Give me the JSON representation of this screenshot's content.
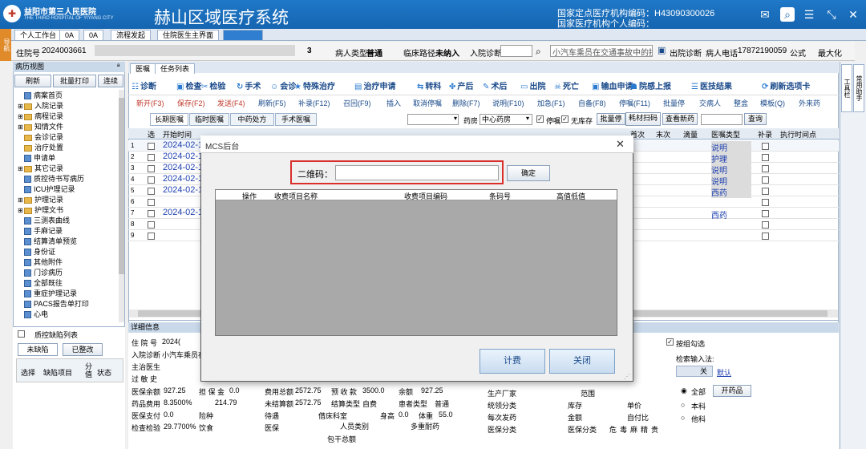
{
  "titlebar": {
    "hospital_name": "益阳市第三人民医院",
    "hospital_en": "THE THIRD HOSPITAL OF YIYANG CITY",
    "app_title": "赫山区域医疗系统",
    "org_code_line": "国家定点医疗机构编码：H43090300026",
    "person_code_line": "国家医疗机构个人编码："
  },
  "left_vertical_tab": "导航",
  "tabs": [
    "个人工作台",
    "0A",
    "0A",
    "流程发起",
    "住院医生主界面",
    ""
  ],
  "patient_bar": {
    "admission_no_label": "住院号",
    "admission_no": "2024003661",
    "bed_count": "3",
    "patient_type_label": "病人类型",
    "patient_type": "普通",
    "clinical_path_label": "临床路径",
    "clinical_path": "未纳入",
    "admit_diag_label": "入院诊断",
    "diag_text": "小汽车乘员在交通事故中的损",
    "discharge_diag": "出院诊断",
    "phone_label": "病人电话",
    "phone": "17872190059",
    "fee_type": "公式",
    "maximize": "最大化"
  },
  "left_panel": {
    "title": "病历视图",
    "pin": "ª",
    "buttons": [
      "刷新",
      "批量打印",
      "连续"
    ],
    "tree": [
      {
        "label": "病案首页",
        "kind": "doc",
        "exp": ""
      },
      {
        "label": "入院记录",
        "kind": "folder",
        "exp": "⊞"
      },
      {
        "label": "病程记录",
        "kind": "folder",
        "exp": "⊞"
      },
      {
        "label": "知情文件",
        "kind": "folder",
        "exp": "⊞"
      },
      {
        "label": "会诊记录",
        "kind": "folder",
        "exp": ""
      },
      {
        "label": "治疗处置",
        "kind": "folder",
        "exp": ""
      },
      {
        "label": "申请单",
        "kind": "doc",
        "exp": ""
      },
      {
        "label": "其它记录",
        "kind": "folder",
        "exp": "⊞"
      },
      {
        "label": "质控待书写病历",
        "kind": "doc",
        "exp": ""
      },
      {
        "label": "ICU护理记录",
        "kind": "doc",
        "exp": ""
      },
      {
        "label": "护理记录",
        "kind": "folder",
        "exp": "⊞"
      },
      {
        "label": "护理文书",
        "kind": "folder",
        "exp": "⊞"
      },
      {
        "label": "三测表曲线",
        "kind": "doc",
        "exp": ""
      },
      {
        "label": "手麻记录",
        "kind": "doc",
        "exp": ""
      },
      {
        "label": "结算清单预览",
        "kind": "doc",
        "exp": ""
      },
      {
        "label": "身份证",
        "kind": "doc",
        "exp": ""
      },
      {
        "label": "其他附件",
        "kind": "doc",
        "exp": ""
      },
      {
        "label": "门诊病历",
        "kind": "doc",
        "exp": ""
      },
      {
        "label": "全部既往",
        "kind": "doc",
        "exp": ""
      },
      {
        "label": "重症护理记录",
        "kind": "doc",
        "exp": ""
      },
      {
        "label": "PACS报告单打印",
        "kind": "doc",
        "exp": ""
      },
      {
        "label": "心电",
        "kind": "doc",
        "exp": ""
      }
    ],
    "qc_title": "质控缺陷列表",
    "defect_tabs": [
      "未缺陷",
      "已整改"
    ],
    "defect_cols": [
      "选择",
      "缺陷项目",
      "分值",
      "状态"
    ]
  },
  "main_tabs": [
    "医嘱",
    "任务列表"
  ],
  "toolbar1": [
    "诊断",
    "检查",
    "检验",
    "手术",
    "会诊",
    "特殊治疗",
    "治疗申请",
    "转科",
    "产后",
    "术后",
    "出院",
    "死亡",
    "输血申请",
    "院感上报",
    "医技结果",
    "刷新选项卡"
  ],
  "toolbar2": [
    "新开(F3)",
    "保存(F2)",
    "发送(F4)",
    "刷新(F5)",
    "补录(F12)",
    "召回(F9)",
    "插入",
    "取消停嘱",
    "删除(F7)",
    "说明(F10)",
    "加急(F1)",
    "自备(F8)",
    "停嘱(F11)",
    "批量停",
    "交病人",
    "整盒",
    "模板(Q)",
    "外来药"
  ],
  "subtabs": [
    "长期医嘱",
    "临时医嘱",
    "中药处方",
    "手术医嘱"
  ],
  "pharmacy": {
    "label": "药房",
    "value": "中心药房",
    "stop_label": "停嘱",
    "nostock_label": "无库存",
    "batch_stop": "批量停",
    "scan": "耗材扫码",
    "view_new": "查看新药",
    "query": "查询"
  },
  "grid": {
    "headers": [
      "选",
      "开始时间",
      "",
      "",
      "",
      "",
      "",
      "",
      "",
      "",
      "首次",
      "末次",
      "滴量",
      "医嘱类型",
      "补录",
      "执行时间点"
    ],
    "rows": [
      {
        "n": "1",
        "date": "2024-02-1",
        "type": "说明"
      },
      {
        "n": "2",
        "date": "2024-02-1",
        "type": "护理"
      },
      {
        "n": "3",
        "date": "2024-02-1",
        "type": "说明"
      },
      {
        "n": "4",
        "date": "2024-02-1",
        "type": "说明"
      },
      {
        "n": "5",
        "date": "2024-02-1",
        "type": "西药"
      },
      {
        "n": "6",
        "date": "",
        "type": ""
      },
      {
        "n": "7",
        "date": "2024-02-1",
        "type": "西药"
      },
      {
        "n": "8",
        "date": "",
        "type": ""
      },
      {
        "n": "9",
        "date": "",
        "type": ""
      }
    ]
  },
  "detail": {
    "title": "详细信息",
    "admission_no_label": "住 院 号",
    "admission_no": "2024(",
    "admit_diag_label": "入院诊断",
    "admit_diag": "小汽车乘员在",
    "doctor_label": "主治医生",
    "allergy_label": "过 敏 史",
    "insurance_balance_label": "医保余额",
    "insurance_balance": "927.25",
    "deposit_label": "担 保 金",
    "deposit": "0.0",
    "total_fee_label": "费用总额",
    "total_fee": "2572.75",
    "prepaid_label": "预 收 款",
    "prepaid": "3500.0",
    "balance_label": "余额",
    "balance": "927.25",
    "drug_ratio_label": "药品费用",
    "drug_ratio": "8.3500%",
    "drug_amount": "214.79",
    "unsettled_label": "未结算额",
    "unsettled": "2572.75",
    "settle_type_label": "结算类型",
    "settle_type": "自费",
    "patient_type_label": "患者类型",
    "patient_type": "普通",
    "ins_pay_label": "医保支付",
    "ins_pay": "0.0",
    "advance_label": "险种",
    "pending_label": "待遇",
    "dept_label": "借床科室",
    "height_label": "身高",
    "height": "0.0",
    "weight_label": "体重",
    "weight": "55.0",
    "exam_ratio_label": "检查检验",
    "exam_ratio": "29.7700%",
    "diet_label": "饮食",
    "ins_label": "医保",
    "person_cat_label": "人员类别",
    "multi_label": "多重耐药",
    "total_pkg": "包干总额",
    "manufacturer_label": "生产厂家",
    "range_label": "范围",
    "stats_label": "统领分类",
    "stock_label": "库存",
    "unit_price_label": "单价",
    "each_dose_label": "每次发药",
    "amount_label": "金额",
    "self_pay_label": "自付比",
    "ins_cat_label": "医保分类",
    "hazard_tags": [
      "危",
      "毒",
      "麻",
      "精",
      "贵"
    ],
    "group_check": "按组勾选",
    "search_method": "检索输入法:",
    "off_btn": "关",
    "default_btn": "默认",
    "radio_all": "全部",
    "radio_dept": "本科",
    "radio_other": "他科",
    "open_drug": "开药品"
  },
  "dialog": {
    "title": "MCS后台",
    "close": "✕",
    "qr_label": "二维码：",
    "qr_value": "",
    "ok": "确定",
    "cols": [
      "操作",
      "收费项目名称",
      "收费项目编码",
      "条码号",
      "高值低值"
    ],
    "fee": "计费",
    "close_btn": "关闭"
  },
  "right_bar": [
    "工具栏",
    "常用助手"
  ],
  "colors": {
    "titlebar": "#1565b0",
    "accent_red": "#d9302c",
    "link_blue": "#1d3fb0"
  }
}
